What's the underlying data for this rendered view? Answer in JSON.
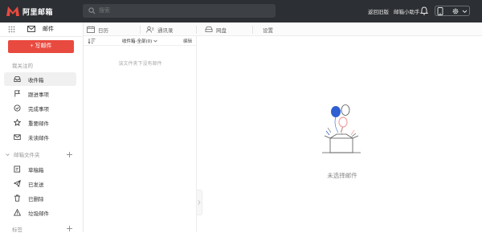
{
  "header": {
    "logo_text": "阿里邮箱",
    "search_placeholder": "搜索",
    "link_old_version": "返回旧版",
    "link_assistant": "邮箱小助手"
  },
  "sidebar": {
    "app_tab_label": "邮件",
    "compose_label": "+ 写邮件",
    "section_followed": "我关注的",
    "items": [
      {
        "label": "收件箱",
        "icon": "inbox-icon"
      },
      {
        "label": "跟进事项",
        "icon": "flag-icon"
      },
      {
        "label": "完成事项",
        "icon": "check-circle-icon"
      },
      {
        "label": "重要邮件",
        "icon": "star-icon"
      },
      {
        "label": "未读邮件",
        "icon": "envelope-icon"
      }
    ],
    "section_folders": "邮箱文件夹",
    "folders": [
      {
        "label": "草稿箱",
        "icon": "draft-icon"
      },
      {
        "label": "已发送",
        "icon": "send-icon"
      },
      {
        "label": "已删除",
        "icon": "trash-icon"
      },
      {
        "label": "垃圾邮件",
        "icon": "warning-icon"
      }
    ],
    "section_tags": "标签"
  },
  "tabs": [
    {
      "label": "日历",
      "icon": "calendar-icon"
    },
    {
      "label": "通讯录",
      "icon": "contacts-icon"
    },
    {
      "label": "网盘",
      "icon": "disk-icon"
    },
    {
      "label": "设置",
      "icon": ""
    }
  ],
  "list": {
    "folder_select": "收件箱-全部(0)",
    "edit_label": "编辑",
    "empty_text": "该文件夹下没有邮件"
  },
  "reading": {
    "empty_text": "未选择邮件"
  },
  "colors": {
    "topbar": "#2c2f33",
    "brand_red": "#e94a3f",
    "balloon_blue": "#2f5fd1",
    "balloon_pink": "#f3a3a3"
  }
}
